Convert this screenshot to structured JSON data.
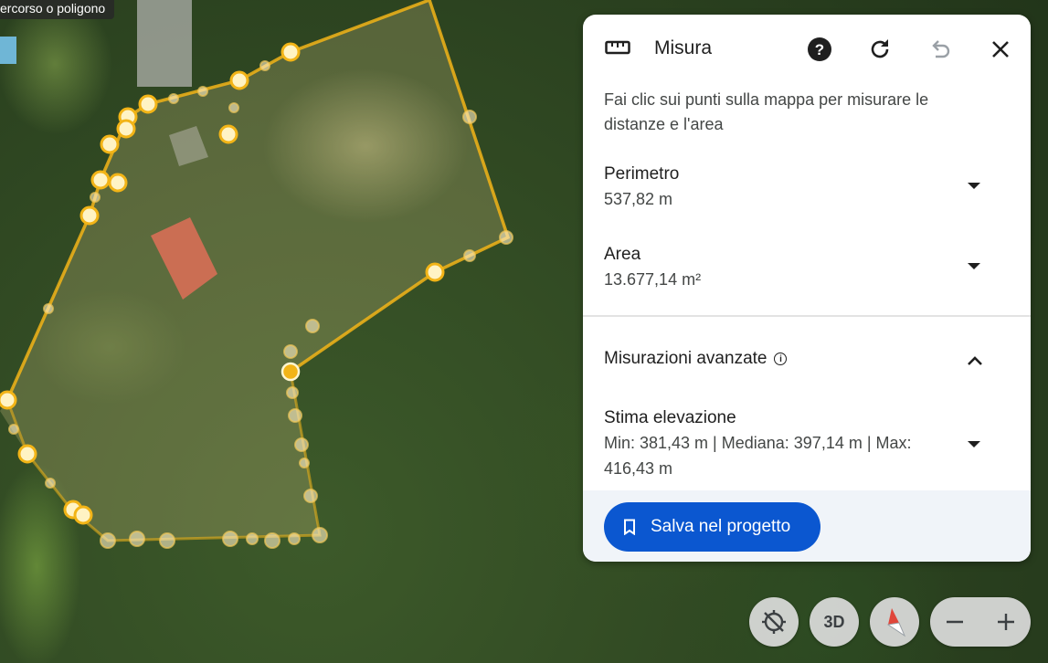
{
  "map": {
    "tooltip": "ercorso o poligono"
  },
  "panel": {
    "title": "Misura",
    "icons": {
      "ruler": "ruler-icon",
      "help": "help-icon",
      "reset": "refresh-icon",
      "undo": "undo-icon",
      "close": "close-icon"
    },
    "description": "Fai clic sui punti sulla mappa per misurare le distanze e l'area",
    "perimeter": {
      "label": "Perimetro",
      "value": "537,82 m"
    },
    "area": {
      "label": "Area",
      "value": "13.677,14 m²"
    },
    "advanced": {
      "label": "Misurazioni avanzate"
    },
    "elevation": {
      "label": "Stima elevazione",
      "value": "Min: 381,43 m | Mediana: 397,14 m | Max: 416,43 m"
    },
    "save_label": "Salva nel progetto"
  },
  "controls": {
    "threed_label": "3D",
    "colors": {
      "accent": "#0b57d0",
      "path": "#f2b417"
    }
  }
}
